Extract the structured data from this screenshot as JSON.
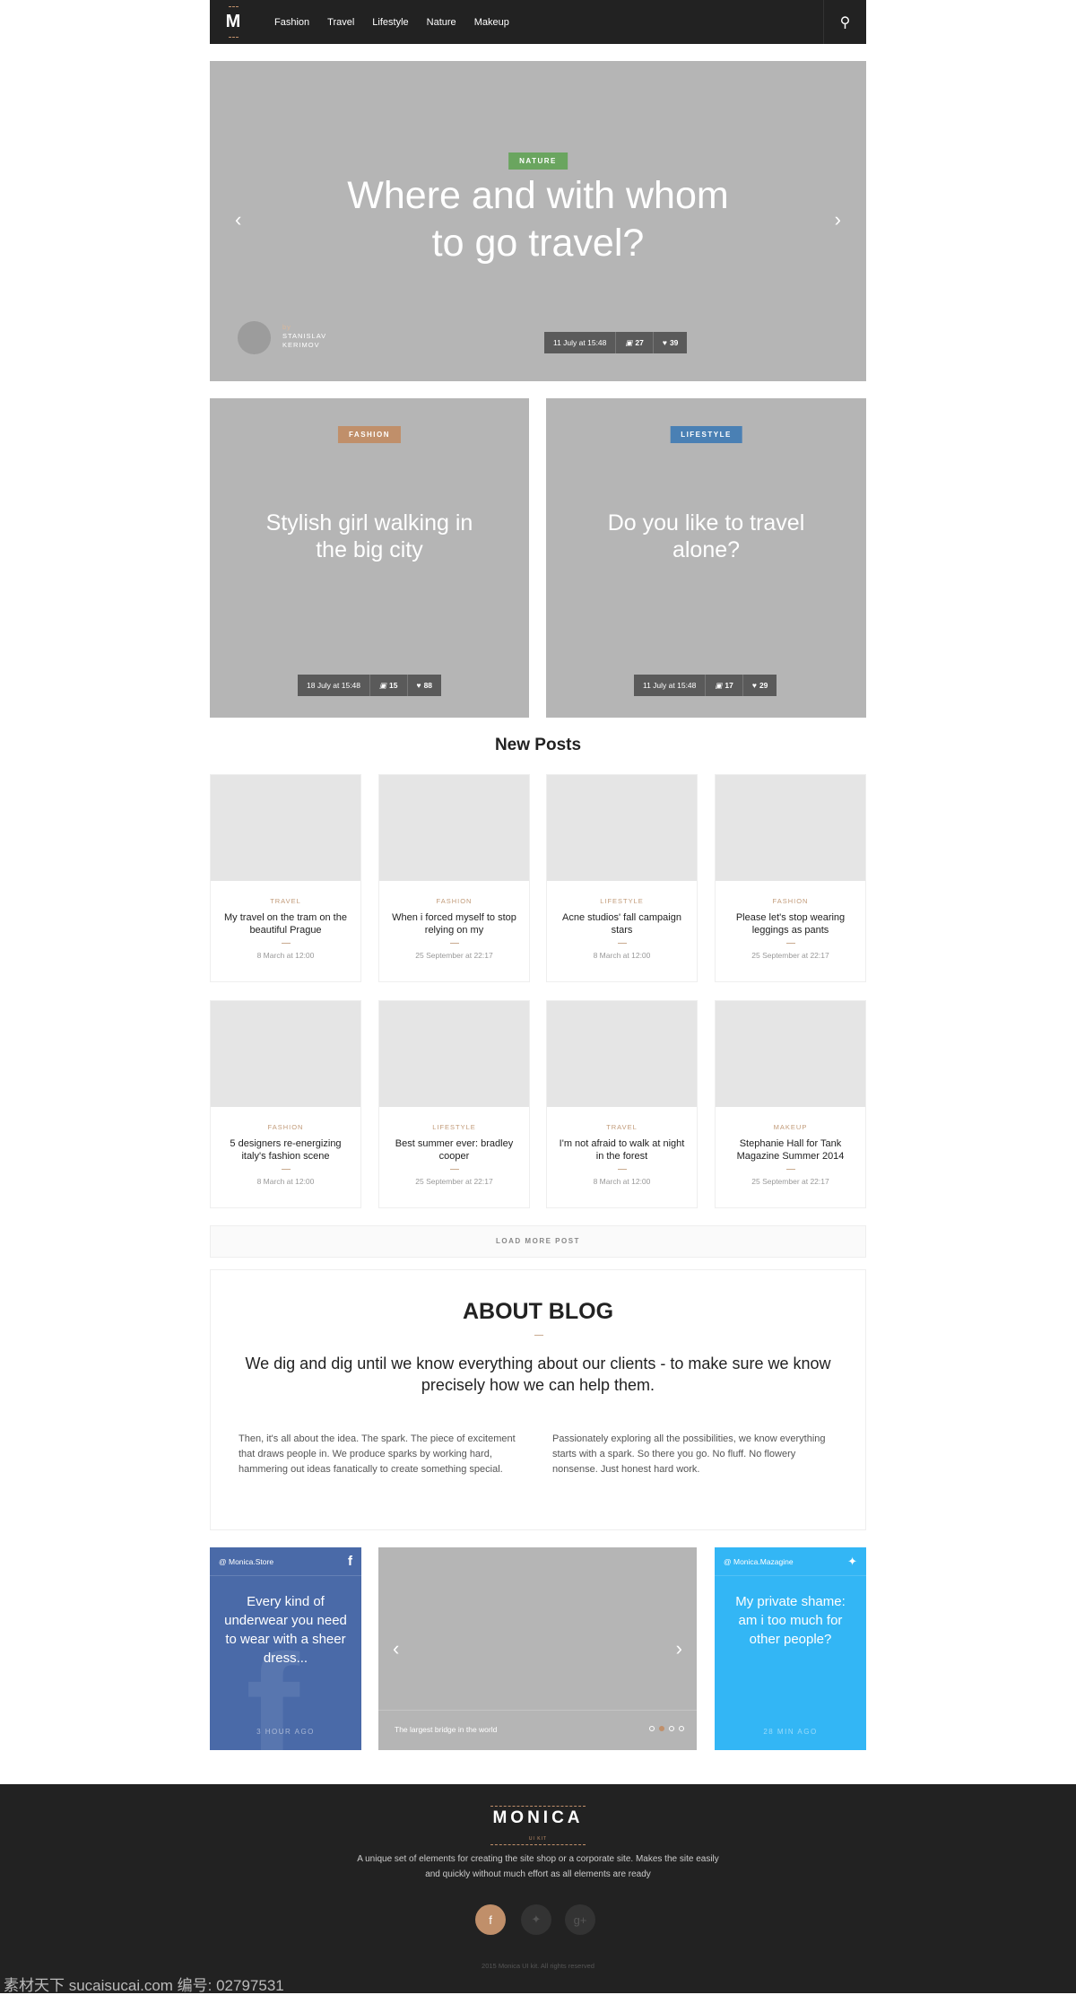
{
  "nav": {
    "logo": "M",
    "items": [
      "Fashion",
      "Travel",
      "Lifestyle",
      "Nature",
      "Makeup"
    ]
  },
  "hero": {
    "tag": "NATURE",
    "tag_color": "#6aa55f",
    "title1": "Where and with whom",
    "title2": "to go travel?",
    "by": "by",
    "author1": "STANISLAV",
    "author2": "KERIMOV",
    "date": "11 July at 15:48",
    "comments": "27",
    "likes": "39"
  },
  "features": [
    {
      "tag": "FASHION",
      "tag_color": "#c08f6a",
      "title1": "Stylish girl walking in",
      "title2": "the big city",
      "date": "18 July at 15:48",
      "comments": "15",
      "likes": "88"
    },
    {
      "tag": "LIFESTYLE",
      "tag_color": "#4a80b4",
      "title1": "Do you like to travel",
      "title2": "alone?",
      "date": "11 July at 15:48",
      "comments": "17",
      "likes": "29"
    }
  ],
  "new_posts": {
    "title": "New Posts",
    "posts": [
      {
        "cat": "TRAVEL",
        "title": "My travel on the tram on the beautiful Prague",
        "date": "8 March at 12:00"
      },
      {
        "cat": "FASHION",
        "title": "When i forced myself to stop relying on my",
        "date": "25 September at 22:17"
      },
      {
        "cat": "LIFESTYLE",
        "title": "Acne studios' fall campaign stars",
        "date": "8 March at 12:00"
      },
      {
        "cat": "FASHION",
        "title": "Please let's stop wearing leggings as pants",
        "date": "25 September at 22:17"
      },
      {
        "cat": "FASHION",
        "title": "5 designers re-energizing italy's fashion scene",
        "date": "8 March at 12:00"
      },
      {
        "cat": "LIFESTYLE",
        "title": "Best summer ever: bradley cooper",
        "date": "25 September at 22:17"
      },
      {
        "cat": "TRAVEL",
        "title": "I'm not afraid to walk at night in the forest",
        "date": "8 March at 12:00"
      },
      {
        "cat": "MAKEUP",
        "title": "Stephanie Hall for Tank Magazine Summer 2014",
        "date": "25 September at 22:17"
      }
    ],
    "load_more": "LOAD MORE POST"
  },
  "about": {
    "title": "ABOUT BLOG",
    "subtitle": "We dig and dig until we know everything about our clients - to make sure we know precisely how we can help them.",
    "col1": "Then, it's all about the idea. The spark. The piece of excitement that draws people in. We produce sparks by working hard, hammering out ideas fanatically to create something special.",
    "col2": "Passionately exploring all the possibilities, we know everything starts with a spark. So there you go. No fluff. No flowery nonsense. Just honest hard work."
  },
  "social": {
    "facebook": {
      "handle": "@ Monica.Store",
      "text": "Every kind of underwear you need to wear with a sheer dress...",
      "ago": "3 HOUR AGO",
      "color": "#4a6aa8"
    },
    "slider": {
      "caption": "The largest bridge in the world",
      "active_dot": 2,
      "dots": 4
    },
    "twitter": {
      "handle": "@ Monica.Mazagine",
      "text": "My private shame: am i too much for other people?",
      "ago": "28 MIN AGO",
      "color": "#33b6f5"
    }
  },
  "footer": {
    "logo": "MONICA",
    "logo_sub": "UI KIT",
    "desc1": "A unique set of elements for creating the site shop or a corporate site. Makes the site easily",
    "desc2": "and quickly without much effort as all elements are ready",
    "copyright": "2015 Monica UI kit. All rights reserved",
    "accent": "#c08f6a"
  },
  "watermark": "素材天下 sucaisucai.com  编号: 02797531"
}
